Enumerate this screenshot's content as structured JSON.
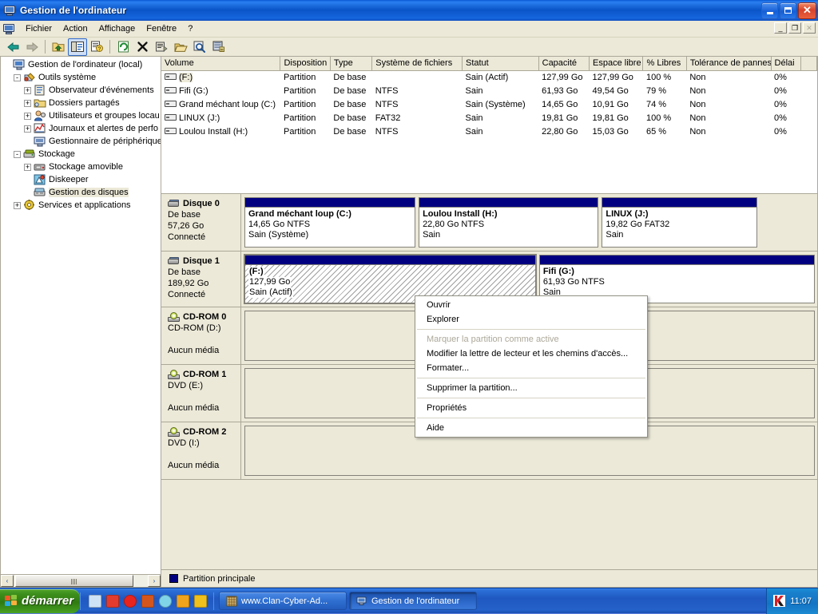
{
  "window": {
    "title": "Gestion de l'ordinateur",
    "title_icon": "computer-icon",
    "minimize_label": "_",
    "maximize_label": "",
    "close_label": "✕"
  },
  "menubar": {
    "icon": "computer-small-icon",
    "items": [
      {
        "label": "Fichier"
      },
      {
        "label": "Action"
      },
      {
        "label": "Affichage"
      },
      {
        "label": "Fenêtre"
      },
      {
        "label": "?"
      }
    ],
    "mdi_buttons": [
      {
        "name": "mdi-minimize",
        "glyph": "_"
      },
      {
        "name": "mdi-restore",
        "glyph": "❐"
      },
      {
        "name": "mdi-close",
        "glyph": "✕",
        "disabled": true
      }
    ]
  },
  "toolbar": {
    "buttons": [
      {
        "name": "back-icon",
        "tooltip": "Précédent",
        "enabled": true
      },
      {
        "name": "forward-icon",
        "tooltip": "Suivant",
        "enabled": false
      },
      {
        "name": "up-folder-icon",
        "tooltip": "Dossier parent",
        "enabled": true
      },
      {
        "name": "show-tree-icon",
        "tooltip": "Afficher/Masquer l'arborescence",
        "enabled": true,
        "pressed": true
      },
      {
        "name": "properties-icon",
        "tooltip": "Propriétés",
        "enabled": true
      },
      {
        "name": "refresh-icon",
        "tooltip": "Actualiser",
        "enabled": true
      },
      {
        "name": "delete-icon",
        "tooltip": "Supprimer",
        "enabled": true
      },
      {
        "name": "properties-page-icon",
        "tooltip": "Propriétés",
        "enabled": true
      },
      {
        "name": "open-folder-icon",
        "tooltip": "Ouvrir",
        "enabled": true
      },
      {
        "name": "search-icon",
        "tooltip": "Rechercher",
        "enabled": true
      },
      {
        "name": "rescan-disks-icon",
        "tooltip": "Analyser de nouveau les disques",
        "enabled": true
      }
    ]
  },
  "tree": {
    "nodes": [
      {
        "label": "Gestion de l'ordinateur (local)",
        "level": 0,
        "expander": "",
        "icon": "computer-icon",
        "selected": false
      },
      {
        "label": "Outils système",
        "level": 1,
        "expander": "-",
        "icon": "system-tools-icon",
        "selected": false
      },
      {
        "label": "Observateur d'événements",
        "level": 2,
        "expander": "+",
        "icon": "event-viewer-icon",
        "selected": false
      },
      {
        "label": "Dossiers partagés",
        "level": 2,
        "expander": "+",
        "icon": "shared-folders-icon",
        "selected": false
      },
      {
        "label": "Utilisateurs et groupes locau",
        "level": 2,
        "expander": "+",
        "icon": "local-users-icon",
        "selected": false
      },
      {
        "label": "Journaux et alertes de perfo",
        "level": 2,
        "expander": "+",
        "icon": "perf-logs-icon",
        "selected": false
      },
      {
        "label": "Gestionnaire de périphérique",
        "level": 2,
        "expander": "",
        "icon": "device-manager-icon",
        "selected": false
      },
      {
        "label": "Stockage",
        "level": 1,
        "expander": "-",
        "icon": "storage-icon",
        "selected": false
      },
      {
        "label": "Stockage amovible",
        "level": 2,
        "expander": "+",
        "icon": "removable-storage-icon",
        "selected": false
      },
      {
        "label": "Diskeeper",
        "level": 2,
        "expander": "",
        "icon": "diskeeper-icon",
        "selected": false
      },
      {
        "label": "Gestion des disques",
        "level": 2,
        "expander": "",
        "icon": "disk-management-icon",
        "selected": true
      },
      {
        "label": "Services et applications",
        "level": 1,
        "expander": "+",
        "icon": "services-icon",
        "selected": false
      }
    ]
  },
  "volume_list": {
    "columns": [
      {
        "label": "Volume",
        "width": 148
      },
      {
        "label": "Disposition",
        "width": 62
      },
      {
        "label": "Type",
        "width": 52
      },
      {
        "label": "Système de fichiers",
        "width": 112
      },
      {
        "label": "Statut",
        "width": 95
      },
      {
        "label": "Capacité",
        "width": 63
      },
      {
        "label": "Espace libre",
        "width": 67
      },
      {
        "label": "% Libres",
        "width": 54
      },
      {
        "label": "Tolérance de pannes",
        "width": 105
      },
      {
        "label": "Délai",
        "width": 37
      },
      {
        "label": "",
        "width": 20
      }
    ],
    "rows": [
      {
        "selected": true,
        "volume": "(F:)",
        "disposition": "Partition",
        "type": "De base",
        "filesystem": "",
        "status": "Sain (Actif)",
        "capacity": "127,99 Go",
        "free": "127,99 Go",
        "percent_free": "100 %",
        "fault_tolerance": "Non",
        "overhead": "0%"
      },
      {
        "selected": false,
        "volume": "Fifi (G:)",
        "disposition": "Partition",
        "type": "De base",
        "filesystem": "NTFS",
        "status": "Sain",
        "capacity": "61,93 Go",
        "free": "49,54 Go",
        "percent_free": "79 %",
        "fault_tolerance": "Non",
        "overhead": "0%"
      },
      {
        "selected": false,
        "volume": "Grand méchant loup (C:)",
        "disposition": "Partition",
        "type": "De base",
        "filesystem": "NTFS",
        "status": "Sain (Système)",
        "capacity": "14,65 Go",
        "free": "10,91 Go",
        "percent_free": "74 %",
        "fault_tolerance": "Non",
        "overhead": "0%"
      },
      {
        "selected": false,
        "volume": "LINUX (J:)",
        "disposition": "Partition",
        "type": "De base",
        "filesystem": "FAT32",
        "status": "Sain",
        "capacity": "19,81 Go",
        "free": "19,81 Go",
        "percent_free": "100 %",
        "fault_tolerance": "Non",
        "overhead": "0%"
      },
      {
        "selected": false,
        "volume": "Loulou Install (H:)",
        "disposition": "Partition",
        "type": "De base",
        "filesystem": "NTFS",
        "status": "Sain",
        "capacity": "22,80 Go",
        "free": "15,03 Go",
        "percent_free": "65 %",
        "fault_tolerance": "Non",
        "overhead": "0%"
      }
    ]
  },
  "graphic_view": {
    "disks": [
      {
        "icon": "disk-icon",
        "name": "Disque 0",
        "type": "De base",
        "size": "57,26 Go",
        "state": "Connecté",
        "partitions": [
          {
            "title": "Grand méchant loup  (C:)",
            "size": "14,65 Go NTFS",
            "status": "Sain (Système)",
            "flex": 207,
            "selected": false
          },
          {
            "title": "Loulou Install  (H:)",
            "size": "22,80 Go NTFS",
            "status": "Sain",
            "flex": 218,
            "selected": false
          },
          {
            "title": "LINUX  (J:)",
            "size": "19,82 Go FAT32",
            "status": "Sain",
            "flex": 188,
            "selected": false
          }
        ],
        "trailing_gap": true
      },
      {
        "icon": "disk-icon",
        "name": "Disque 1",
        "type": "De base",
        "size": "189,92 Go",
        "state": "Connecté",
        "partitions": [
          {
            "title": "(F:)",
            "size": "127,99 Go",
            "status": "Sain (Actif)",
            "flex": 370,
            "selected": true
          },
          {
            "title": "Fifi  (G:)",
            "size": "61,93 Go NTFS",
            "status": "Sain",
            "flex": 350,
            "selected": false
          }
        ],
        "trailing_gap": false
      },
      {
        "icon": "cdrom-icon",
        "name": "CD-ROM 0",
        "type": "CD-ROM (D:)",
        "size": "",
        "state": "Aucun média",
        "partitions": [],
        "trailing_gap": false
      },
      {
        "icon": "cdrom-icon",
        "name": "CD-ROM 1",
        "type": "DVD (E:)",
        "size": "",
        "state": "Aucun média",
        "partitions": [],
        "trailing_gap": false
      },
      {
        "icon": "cdrom-icon",
        "name": "CD-ROM 2",
        "type": "DVD (I:)",
        "size": "",
        "state": "Aucun média",
        "partitions": [],
        "trailing_gap": false
      }
    ]
  },
  "legend": {
    "items": [
      {
        "swatch_color": "#000080",
        "label": "Partition principale"
      }
    ]
  },
  "context_menu": {
    "items": [
      {
        "label": "Ouvrir",
        "disabled": false,
        "separator_after": false
      },
      {
        "label": "Explorer",
        "disabled": false,
        "separator_after": true
      },
      {
        "label": "Marquer la partition comme active",
        "disabled": true,
        "separator_after": false
      },
      {
        "label": "Modifier la lettre de lecteur et les chemins d'accès...",
        "disabled": false,
        "separator_after": false
      },
      {
        "label": "Formater...",
        "disabled": false,
        "separator_after": true
      },
      {
        "label": "Supprimer la partition...",
        "disabled": false,
        "separator_after": true
      },
      {
        "label": "Propriétés",
        "disabled": false,
        "separator_after": true
      },
      {
        "label": "Aide",
        "disabled": false,
        "separator_after": false
      }
    ]
  },
  "tree_scrollbar": {
    "left_arrow": "‹",
    "right_arrow": "›"
  },
  "taskbar": {
    "start_label": "démarrer",
    "quick_launch": [
      {
        "name": "quicklaunch-icon-1",
        "color": "#cfe3f7"
      },
      {
        "name": "quicklaunch-icon-2",
        "color": "#e33b2e"
      },
      {
        "name": "quicklaunch-opera-icon",
        "color": "#e8241f"
      },
      {
        "name": "quicklaunch-firefox-icon",
        "color": "#d4561c"
      },
      {
        "name": "quicklaunch-icon-5",
        "color": "#7fd4e8"
      },
      {
        "name": "quicklaunch-icon-6",
        "color": "#f0a41c"
      },
      {
        "name": "quicklaunch-icon-7",
        "color": "#f0c01c"
      }
    ],
    "tasks": [
      {
        "label": "www.Clan-Cyber-Ad...",
        "icon": "browser-icon",
        "active": false
      },
      {
        "label": "Gestion de l'ordinateur",
        "icon": "computer-icon",
        "active": true
      }
    ],
    "tray": {
      "icons": [
        {
          "name": "kaspersky-icon",
          "label": "K"
        }
      ],
      "clock": "11:07"
    }
  }
}
